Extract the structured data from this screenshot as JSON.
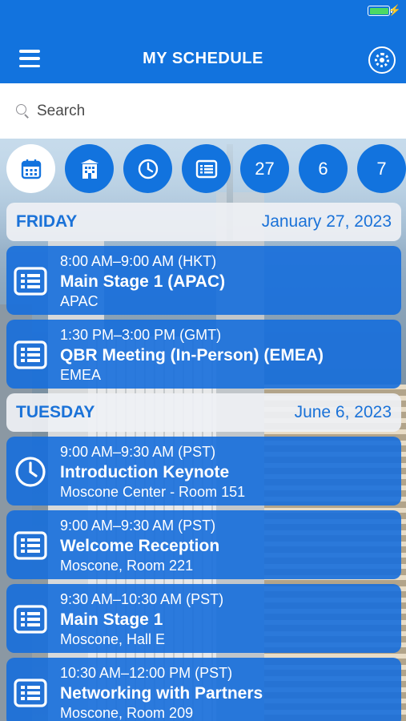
{
  "header": {
    "title": "MY SCHEDULE",
    "menu_icon": "hamburger-menu-icon",
    "settings_icon": "gear-icon",
    "brand_color": "#1273de"
  },
  "status": {
    "battery_color": "#4cd964"
  },
  "search": {
    "placeholder": "Search",
    "value": ""
  },
  "filters": [
    {
      "icon": "calendar-icon",
      "label": "",
      "active": true
    },
    {
      "icon": "building-icon",
      "label": "",
      "active": false
    },
    {
      "icon": "clock-icon",
      "label": "",
      "active": false
    },
    {
      "icon": "list-icon",
      "label": "",
      "active": false
    },
    {
      "icon": "",
      "label": "27",
      "active": false
    },
    {
      "icon": "",
      "label": "6",
      "active": false
    },
    {
      "icon": "",
      "label": "7",
      "active": false
    }
  ],
  "days": [
    {
      "day": "FRIDAY",
      "date": "January 27, 2023",
      "events": [
        {
          "icon": "list-icon",
          "time": "8:00 AM–9:00 AM (HKT)",
          "title": "Main Stage 1  (APAC)",
          "location": "APAC"
        },
        {
          "icon": "list-icon",
          "time": "1:30 PM–3:00 PM (GMT)",
          "title": "QBR Meeting (In-Person) (EMEA)",
          "location": "EMEA"
        }
      ]
    },
    {
      "day": "TUESDAY",
      "date": "June 6, 2023",
      "events": [
        {
          "icon": "clock-icon",
          "time": "9:00 AM–9:30 AM (PST)",
          "title": "Introduction Keynote",
          "location": "Moscone Center - Room 151"
        },
        {
          "icon": "list-icon",
          "time": "9:00 AM–9:30 AM (PST)",
          "title": "Welcome Reception",
          "location": "Moscone, Room 221"
        },
        {
          "icon": "list-icon",
          "time": "9:30 AM–10:30 AM (PST)",
          "title": "Main Stage 1",
          "location": "Moscone, Hall E"
        },
        {
          "icon": "list-icon",
          "time": "10:30 AM–12:00 PM (PST)",
          "title": "Networking with Partners",
          "location": "Moscone, Room 209"
        }
      ]
    }
  ]
}
